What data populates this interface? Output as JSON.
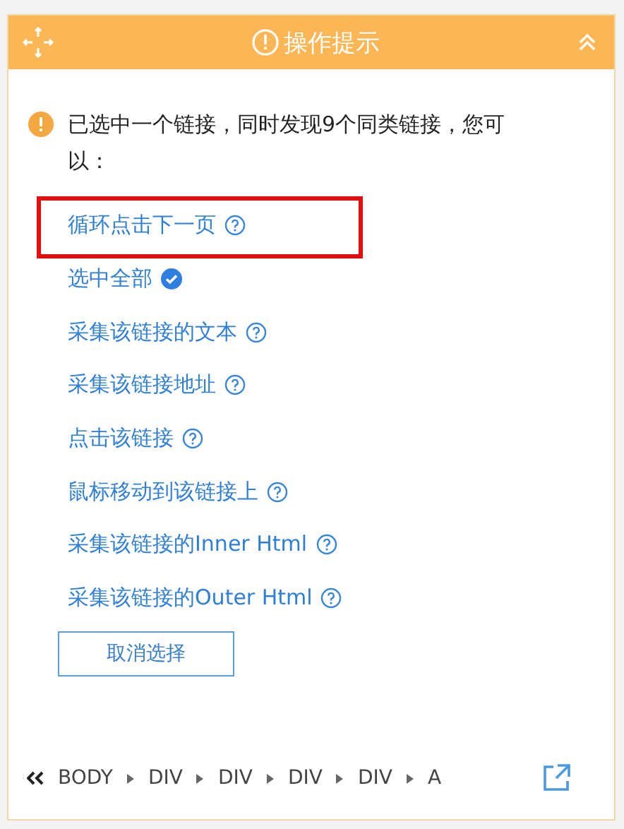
{
  "header": {
    "title": "操作提示"
  },
  "message": {
    "text": "已选中一个链接，同时发现9个同类链接，您可以："
  },
  "options": [
    {
      "label": "循环点击下一页",
      "kind": "help",
      "highlighted": true
    },
    {
      "label": "选中全部",
      "kind": "check",
      "highlighted": false
    },
    {
      "label": "采集该链接的文本",
      "kind": "help",
      "highlighted": false
    },
    {
      "label": "采集该链接地址",
      "kind": "help",
      "highlighted": false
    },
    {
      "label": "点击该链接",
      "kind": "help",
      "highlighted": false
    },
    {
      "label": "鼠标移动到该链接上",
      "kind": "help",
      "highlighted": false
    },
    {
      "label": "采集该链接的Inner Html",
      "kind": "help",
      "highlighted": false
    },
    {
      "label": "采集该链接的Outer Html",
      "kind": "help",
      "highlighted": false
    }
  ],
  "cancel_button": {
    "label": "取消选择"
  },
  "breadcrumb": [
    "BODY",
    "DIV",
    "DIV",
    "DIV",
    "DIV",
    "A"
  ]
}
